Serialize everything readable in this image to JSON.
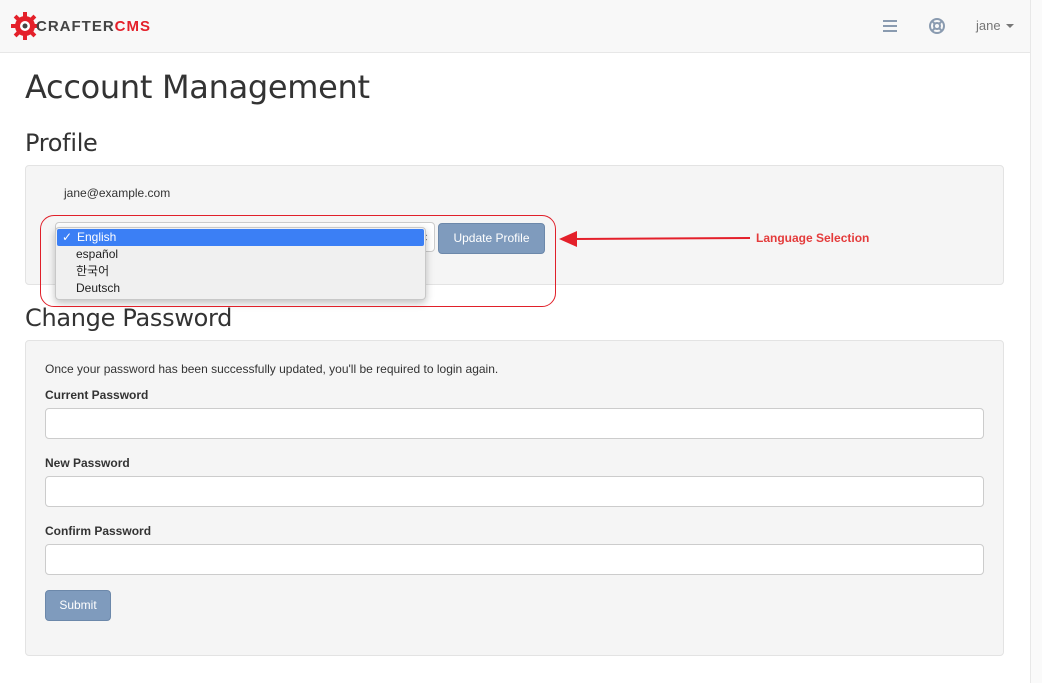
{
  "navbar": {
    "brand_part1": "CRAFTER",
    "brand_part2": "CMS",
    "user_name": "jane",
    "icons": [
      "menu-lines-icon",
      "help-lifebuoy-icon",
      "chevron-down-icon"
    ]
  },
  "page": {
    "title": "Account Management"
  },
  "profile": {
    "title": "Profile",
    "email": "jane@example.com",
    "language_options": [
      "English",
      "español",
      "한국어",
      "Deutsch"
    ],
    "selected_language": "English",
    "check_mark": "✓",
    "update_button_label": "Update Profile"
  },
  "annotation": {
    "label": "Language Selection"
  },
  "change_password": {
    "title": "Change Password",
    "info": "Once your password has been successfully updated, you'll be required to login again.",
    "current_password_label": "Current Password",
    "new_password_label": "New Password",
    "confirm_password_label": "Confirm Password",
    "current_password_value": "",
    "new_password_value": "",
    "confirm_password_value": "",
    "submit_label": "Submit"
  },
  "colors": {
    "brand_red": "#e4202a",
    "button_blue": "#7f9bbd",
    "selection_blue": "#3b7ff5",
    "annotation_red": "#e43b3b"
  }
}
